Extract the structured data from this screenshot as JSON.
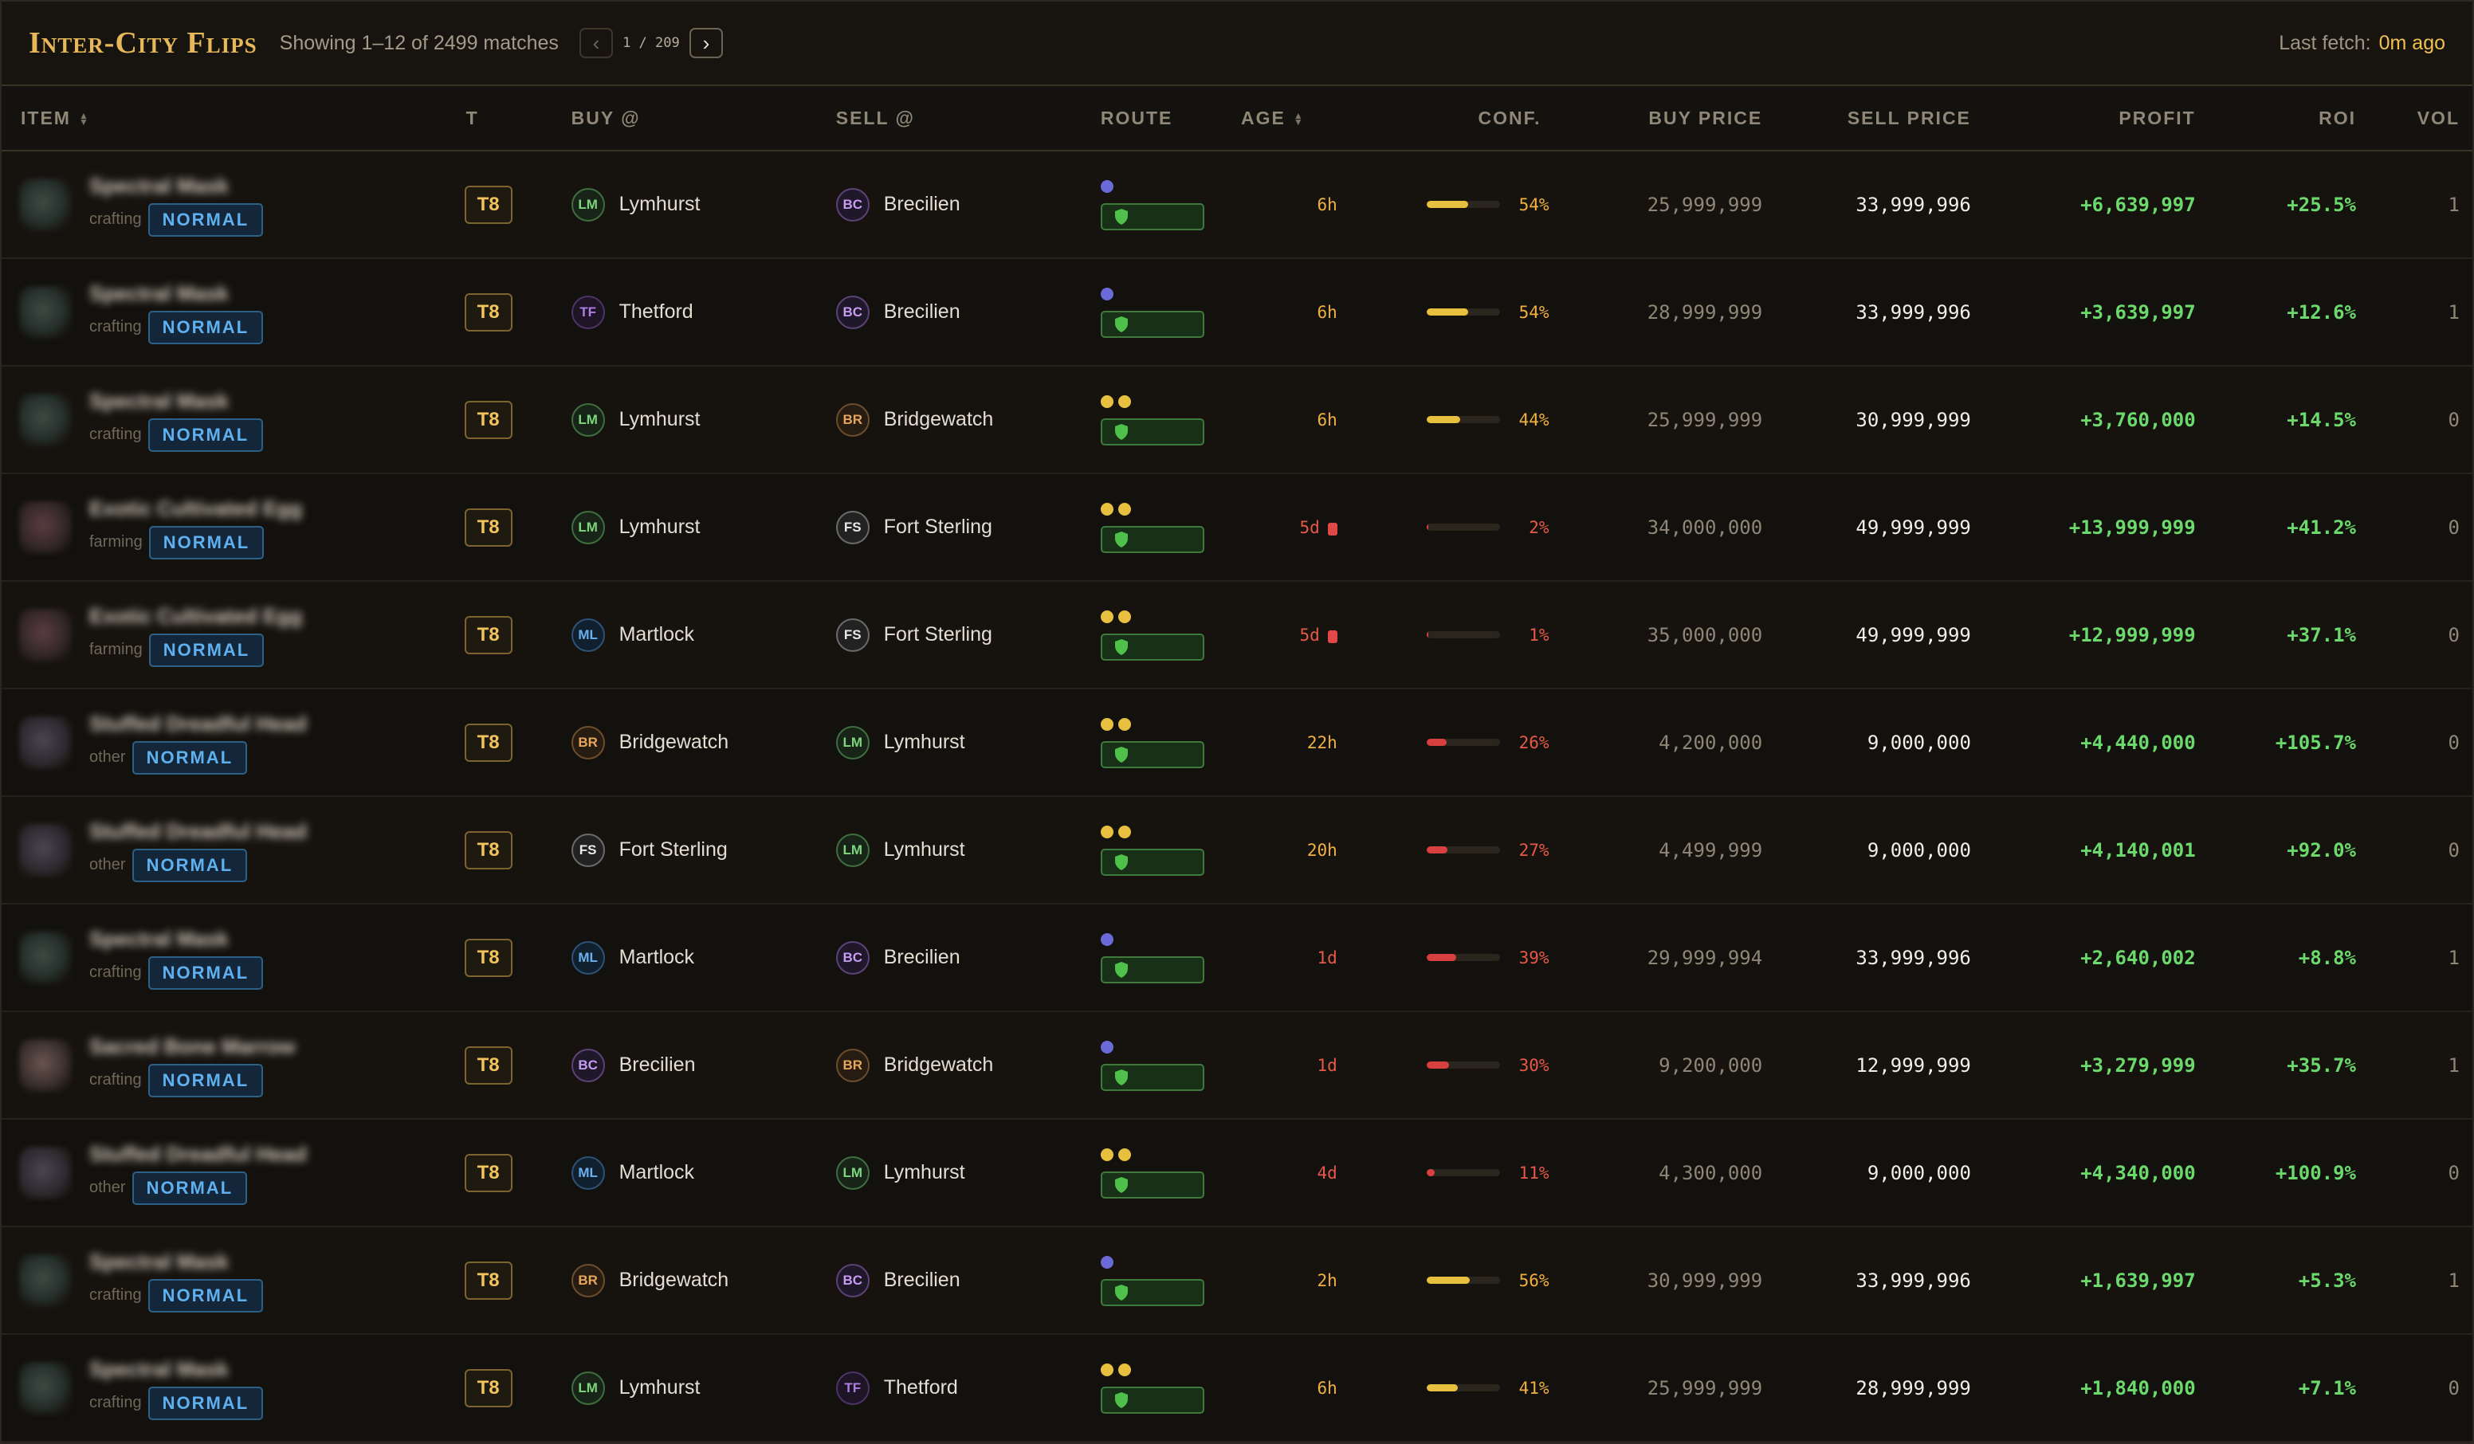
{
  "header": {
    "title": "Inter-City Flips",
    "showing": "Showing 1–12 of 2499 matches",
    "prev_symbol": "‹",
    "next_symbol": "›",
    "page_text": "1 / 209",
    "last_fetch_label": "Last fetch:",
    "last_fetch_value": "0m ago"
  },
  "columns": {
    "item": "ITEM",
    "tier": "T",
    "buy_at": "BUY @",
    "sell_at": "SELL @",
    "route": "ROUTE",
    "age": "AGE",
    "conf": "CONF.",
    "buy_price": "BUY PRICE",
    "sell_price": "SELL PRICE",
    "profit": "PROFIT",
    "roi": "ROI",
    "vol": "VOL"
  },
  "colors": {
    "accent": "#e6b85a",
    "profit": "#6cd96c",
    "warn": "#f0b040",
    "danger": "#e85848"
  },
  "rows": [
    {
      "name": "Spectral Mask",
      "cat": "crafting",
      "thumb": "",
      "quality": "NORMAL",
      "tier": "T8",
      "buy_code": "LM",
      "buy": "Lymhurst",
      "sell_code": "BC",
      "sell": "Brecilien",
      "route": "blue",
      "age": "6h",
      "age_style": "y",
      "lock": false,
      "conf": 0.54,
      "conf_text": "54%",
      "bar": "#e8c040",
      "buy_price": "25,999,999",
      "sell_price": "33,999,996",
      "profit": "+6,639,997",
      "roi": "+25.5%",
      "vol": "1"
    },
    {
      "name": "Spectral Mask",
      "cat": "crafting",
      "thumb": "",
      "quality": "NORMAL",
      "tier": "T8",
      "buy_code": "TF",
      "buy": "Thetford",
      "sell_code": "BC",
      "sell": "Brecilien",
      "route": "blue",
      "age": "6h",
      "age_style": "y",
      "lock": false,
      "conf": 0.54,
      "conf_text": "54%",
      "bar": "#e8c040",
      "buy_price": "28,999,999",
      "sell_price": "33,999,996",
      "profit": "+3,639,997",
      "roi": "+12.6%",
      "vol": "1"
    },
    {
      "name": "Spectral Mask",
      "cat": "crafting",
      "thumb": "",
      "quality": "NORMAL",
      "tier": "T8",
      "buy_code": "LM",
      "buy": "Lymhurst",
      "sell_code": "BR",
      "sell": "Bridgewatch",
      "route": "yellow",
      "age": "6h",
      "age_style": "y",
      "lock": false,
      "conf": 0.44,
      "conf_text": "44%",
      "bar": "#e8c040",
      "buy_price": "25,999,999",
      "sell_price": "30,999,999",
      "profit": "+3,760,000",
      "roi": "+14.5%",
      "vol": "0"
    },
    {
      "name": "Exotic Cultivated Egg",
      "cat": "farming",
      "thumb": "farm",
      "quality": "NORMAL",
      "tier": "T8",
      "buy_code": "LM",
      "buy": "Lymhurst",
      "sell_code": "FS",
      "sell": "Fort Sterling",
      "route": "yellow",
      "age": "5d",
      "age_style": "r",
      "lock": true,
      "conf": 0.02,
      "conf_text": "2%",
      "bar": "#d84040",
      "buy_price": "34,000,000",
      "sell_price": "49,999,999",
      "profit": "+13,999,999",
      "roi": "+41.2%",
      "vol": "0"
    },
    {
      "name": "Exotic Cultivated Egg",
      "cat": "farming",
      "thumb": "farm",
      "quality": "NORMAL",
      "tier": "T8",
      "buy_code": "ML",
      "buy": "Martlock",
      "sell_code": "FS",
      "sell": "Fort Sterling",
      "route": "yellow",
      "age": "5d",
      "age_style": "r",
      "lock": true,
      "conf": 0.01,
      "conf_text": "1%",
      "bar": "#d84040",
      "buy_price": "35,000,000",
      "sell_price": "49,999,999",
      "profit": "+12,999,999",
      "roi": "+37.1%",
      "vol": "0"
    },
    {
      "name": "Stuffed Dreadful Head",
      "cat": "other",
      "thumb": "other",
      "quality": "NORMAL",
      "tier": "T8",
      "buy_code": "BR",
      "buy": "Bridgewatch",
      "sell_code": "LM",
      "sell": "Lymhurst",
      "route": "yellow",
      "age": "22h",
      "age_style": "y",
      "lock": false,
      "conf": 0.26,
      "conf_text": "26%",
      "bar": "#d84040",
      "buy_price": "4,200,000",
      "sell_price": "9,000,000",
      "profit": "+4,440,000",
      "roi": "+105.7%",
      "vol": "0"
    },
    {
      "name": "Stuffed Dreadful Head",
      "cat": "other",
      "thumb": "other",
      "quality": "NORMAL",
      "tier": "T8",
      "buy_code": "FS",
      "buy": "Fort Sterling",
      "sell_code": "LM",
      "sell": "Lymhurst",
      "route": "yellow",
      "age": "20h",
      "age_style": "y",
      "lock": false,
      "conf": 0.27,
      "conf_text": "27%",
      "bar": "#d84040",
      "buy_price": "4,499,999",
      "sell_price": "9,000,000",
      "profit": "+4,140,001",
      "roi": "+92.0%",
      "vol": "0"
    },
    {
      "name": "Spectral Mask",
      "cat": "crafting",
      "thumb": "",
      "quality": "NORMAL",
      "tier": "T8",
      "buy_code": "ML",
      "buy": "Martlock",
      "sell_code": "BC",
      "sell": "Brecilien",
      "route": "blue",
      "age": "1d",
      "age_style": "r",
      "lock": false,
      "conf": 0.39,
      "conf_text": "39%",
      "bar": "#d84040",
      "buy_price": "29,999,994",
      "sell_price": "33,999,996",
      "profit": "+2,640,002",
      "roi": "+8.8%",
      "vol": "1"
    },
    {
      "name": "Sacred Bone Marrow",
      "cat": "crafting",
      "thumb": "bone",
      "quality": "NORMAL",
      "tier": "T8",
      "buy_code": "BC",
      "buy": "Brecilien",
      "sell_code": "BR",
      "sell": "Bridgewatch",
      "route": "blue",
      "age": "1d",
      "age_style": "r",
      "lock": false,
      "conf": 0.3,
      "conf_text": "30%",
      "bar": "#d84040",
      "buy_price": "9,200,000",
      "sell_price": "12,999,999",
      "profit": "+3,279,999",
      "roi": "+35.7%",
      "vol": "1"
    },
    {
      "name": "Stuffed Dreadful Head",
      "cat": "other",
      "thumb": "other",
      "quality": "NORMAL",
      "tier": "T8",
      "buy_code": "ML",
      "buy": "Martlock",
      "sell_code": "LM",
      "sell": "Lymhurst",
      "route": "yellow",
      "age": "4d",
      "age_style": "r",
      "lock": false,
      "conf": 0.11,
      "conf_text": "11%",
      "bar": "#d84040",
      "buy_price": "4,300,000",
      "sell_price": "9,000,000",
      "profit": "+4,340,000",
      "roi": "+100.9%",
      "vol": "0"
    },
    {
      "name": "Spectral Mask",
      "cat": "crafting",
      "thumb": "",
      "quality": "NORMAL",
      "tier": "T8",
      "buy_code": "BR",
      "buy": "Bridgewatch",
      "sell_code": "BC",
      "sell": "Brecilien",
      "route": "blue",
      "age": "2h",
      "age_style": "y",
      "lock": false,
      "conf": 0.56,
      "conf_text": "56%",
      "bar": "#e8c040",
      "buy_price": "30,999,999",
      "sell_price": "33,999,996",
      "profit": "+1,639,997",
      "roi": "+5.3%",
      "vol": "1"
    },
    {
      "name": "Spectral Mask",
      "cat": "crafting",
      "thumb": "",
      "quality": "NORMAL",
      "tier": "T8",
      "buy_code": "LM",
      "buy": "Lymhurst",
      "sell_code": "TF",
      "sell": "Thetford",
      "route": "yellow",
      "age": "6h",
      "age_style": "y",
      "lock": false,
      "conf": 0.41,
      "conf_text": "41%",
      "bar": "#e8c040",
      "buy_price": "25,999,999",
      "sell_price": "28,999,999",
      "profit": "+1,840,000",
      "roi": "+7.1%",
      "vol": "0"
    }
  ]
}
